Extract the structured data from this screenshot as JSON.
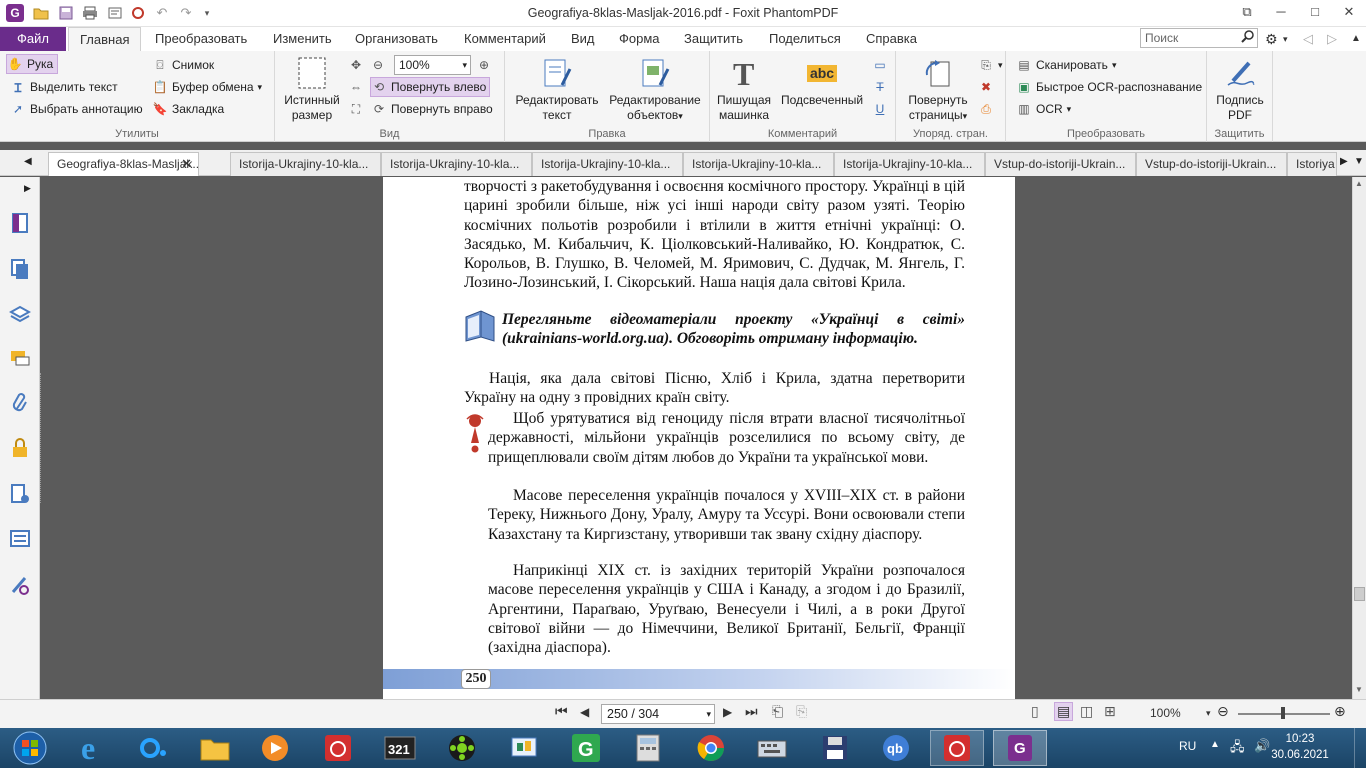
{
  "titlebar": {
    "title": "Geografiya-8klas-Masljak-2016.pdf - Foxit PhantomPDF",
    "logo_letter": "G",
    "controls": {
      "restore": "⧉",
      "minimize": "─",
      "maximize": "□",
      "close": "✕"
    }
  },
  "ribbon_tabs": {
    "file": "Файл",
    "items": [
      "Главная",
      "Преобразовать",
      "Изменить",
      "Организовать",
      "Комментарий",
      "Вид",
      "Форма",
      "Защитить",
      "Поделиться",
      "Справка"
    ],
    "search_placeholder": "Поиск"
  },
  "ribbon": {
    "utilities": {
      "label": "Утилиты",
      "hand": "Рука",
      "select_text": "Выделить текст",
      "select_annotation": "Выбрать аннотацию",
      "snapshot": "Снимок",
      "clipboard": "Буфер обмена",
      "bookmark": "Закладка"
    },
    "view": {
      "label": "Вид",
      "actual_size": "Истинный размер",
      "zoom_value": "100%",
      "rotate_left": "Повернуть влево",
      "rotate_right": "Повернуть вправо"
    },
    "edit": {
      "label": "Правка",
      "edit_text": "Редактировать текст",
      "edit_objects": "Редактирование объектов"
    },
    "comment": {
      "label": "Комментарий",
      "typewriter": "Пишущая машинка",
      "highlight": "Подсвеченный",
      "highlight_icon_text": "abc"
    },
    "pages": {
      "label": "Упоряд. стран.",
      "rotate_pages": "Повернуть страницы"
    },
    "convert": {
      "label": "Преобразовать",
      "scan": "Сканировать",
      "quick_ocr": "Быстрое OCR-распознавание",
      "ocr": "OCR"
    },
    "protect": {
      "label": "Защитить",
      "sign_pdf": "Подпись PDF"
    }
  },
  "doc_tabs": [
    "Geografiya-8klas-Masljak...",
    "Istorija-Ukrajiny-10-kla...",
    "Istorija-Ukrajiny-10-kla...",
    "Istorija-Ukrajiny-10-kla...",
    "Istorija-Ukrajiny-10-kla...",
    "Istorija-Ukrajiny-10-kla...",
    "Vstup-do-istoriji-Ukrain...",
    "Vstup-do-istoriji-Ukrain...",
    "Istoriya"
  ],
  "page": {
    "para1": "творчості з ракетобудування і освоєння космічного простору. Українці в цій царині зробили більше, ніж усі інші народи світу разом узяті. Теорію космічних польотів розробили і втілили в життя етнічні українці: О. Засядько, М. Кибальчич, К. Ціолковський-Наливайко, Ю. Кондратюк, С. Корольов, В. Глушко, В. Челомей, М. Яримович, С. Дудчак, М. Янгель, Г. Лозино-Лозинський, І. Сікорський. Наша нація дала світові Крила.",
    "task": "Перегляньте відеоматеріали проекту «Українці в світі» (ukrainians-world.org.ua). Обговоріть отриману інформацію.",
    "para2": "Нація, яка дала світові Пісню, Хліб і Крила, здатна перетворити Україну на одну з провідних країн світу.",
    "para3": "Щоб урятуватися від геноциду після втрати власної тисячолітньої державності, мільйони українців розселилися по всьому світу, де прищеплювали своїм дітям любов до України та української мови.",
    "para4": "Масове переселення українців почалося у XVIII–XIX ст. в райони Тереку, Нижнього Дону, Уралу, Амуру та Уссурі. Вони освоювали степи Казахстану та Киргизстану, утворивши так звану східну діаспору.",
    "para5": "Наприкінці XIX ст. із західних територій України розпочалося масове переселення українців у США і Канаду, а згодом і до Бразилії, Аргентини, Параґваю, Уруґваю, Венесуели і Чилі, а в роки Другої світової війни — до Німеччини, Великої Британії, Бельгії, Франції (західна діаспора).",
    "page_number": "250"
  },
  "statusbar": {
    "page_indicator": "250 / 304",
    "zoom": "100%"
  },
  "tray": {
    "lang": "RU",
    "time": "10:23",
    "date": "30.06.2021"
  }
}
